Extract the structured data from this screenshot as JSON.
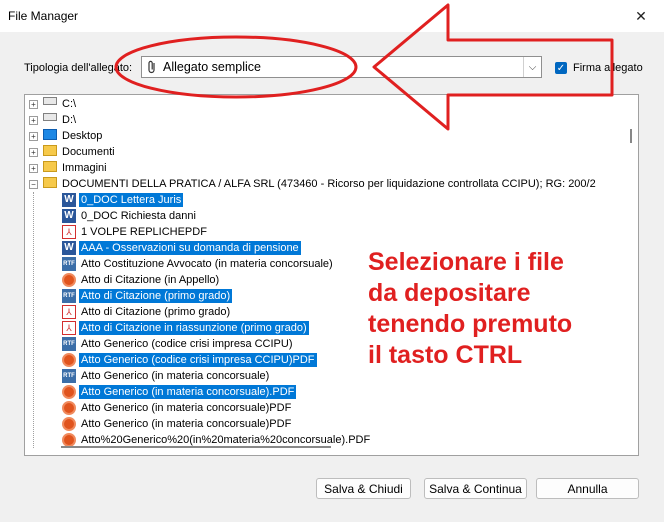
{
  "window": {
    "title": "File Manager",
    "close_glyph": "✕"
  },
  "form": {
    "tipologia_label": "Tipologia dell'allegato:",
    "tipologia_value": "Allegato semplice",
    "firma_label": "Firma allegato",
    "firma_checked": true
  },
  "tree": {
    "items": [
      {
        "label": "C:\\",
        "icon": "drive-icon",
        "level": 0,
        "expander": "+",
        "selected": false
      },
      {
        "label": "D:\\",
        "icon": "drive-icon",
        "level": 0,
        "expander": "+",
        "selected": false
      },
      {
        "label": "Desktop",
        "icon": "desktop-icon",
        "level": 0,
        "expander": "+",
        "selected": false
      },
      {
        "label": "Documenti",
        "icon": "folder-icon",
        "level": 0,
        "expander": "+",
        "selected": false
      },
      {
        "label": "Immagini",
        "icon": "folder-icon",
        "level": 0,
        "expander": "+",
        "selected": false
      },
      {
        "label": "DOCUMENTI DELLA PRATICA / ALFA SRL (473460 - Ricorso per liquidazione controllata CCIPU); RG: 200/2",
        "icon": "folder-icon",
        "level": 0,
        "expander": "−",
        "selected": false
      },
      {
        "label": "0_DOC Lettera Juris",
        "icon": "word-icon",
        "level": 1,
        "selected": true
      },
      {
        "label": "0_DOC Richiesta danni",
        "icon": "word-icon",
        "level": 1,
        "selected": false
      },
      {
        "label": "1 VOLPE REPLICHEPDF",
        "icon": "pdf-icon",
        "level": 1,
        "selected": false
      },
      {
        "label": "AAA - Osservazioni su domanda di pensione",
        "icon": "word-icon",
        "level": 1,
        "selected": true
      },
      {
        "label": "Atto Costituzione Avvocato (in materia concorsuale)",
        "icon": "rtf-icon",
        "level": 1,
        "selected": false
      },
      {
        "label": "Atto di Citazione (in Appello)",
        "icon": "seal-icon",
        "level": 1,
        "selected": false
      },
      {
        "label": "Atto di Citazione (primo grado)",
        "icon": "rtf-icon",
        "level": 1,
        "selected": true
      },
      {
        "label": "Atto di Citazione (primo grado)",
        "icon": "pdf-icon",
        "level": 1,
        "selected": false
      },
      {
        "label": "Atto di Citazione in riassunzione (primo grado)",
        "icon": "pdf-icon",
        "level": 1,
        "selected": true
      },
      {
        "label": "Atto Generico (codice crisi impresa CCIPU)",
        "icon": "rtf-icon",
        "level": 1,
        "selected": false
      },
      {
        "label": "Atto Generico (codice crisi impresa CCIPU)PDF",
        "icon": "seal-icon",
        "level": 1,
        "selected": true
      },
      {
        "label": "Atto Generico (in materia concorsuale)",
        "icon": "rtf-icon",
        "level": 1,
        "selected": false
      },
      {
        "label": "Atto Generico (in materia concorsuale).PDF",
        "icon": "seal-icon",
        "level": 1,
        "selected": true
      },
      {
        "label": "Atto Generico (in materia concorsuale)PDF",
        "icon": "seal-icon",
        "level": 1,
        "selected": false
      },
      {
        "label": "Atto Generico (in materia concorsuale)PDF",
        "icon": "seal-icon",
        "level": 1,
        "selected": false
      },
      {
        "label": "Atto%20Generico%20(in%20materia%20concorsuale).PDF",
        "icon": "seal-icon",
        "level": 1,
        "selected": false
      }
    ]
  },
  "annotation": {
    "text": "Selezionare i file\nda depositare\ntenendo premuto\nil tasto CTRL",
    "color": "#e02020"
  },
  "buttons": {
    "save_close": "Salva & Chiudi",
    "save_continue": "Salva & Continua",
    "cancel": "Annulla"
  },
  "colors": {
    "selection": "#0078d7",
    "annotation_red": "#e02020"
  }
}
